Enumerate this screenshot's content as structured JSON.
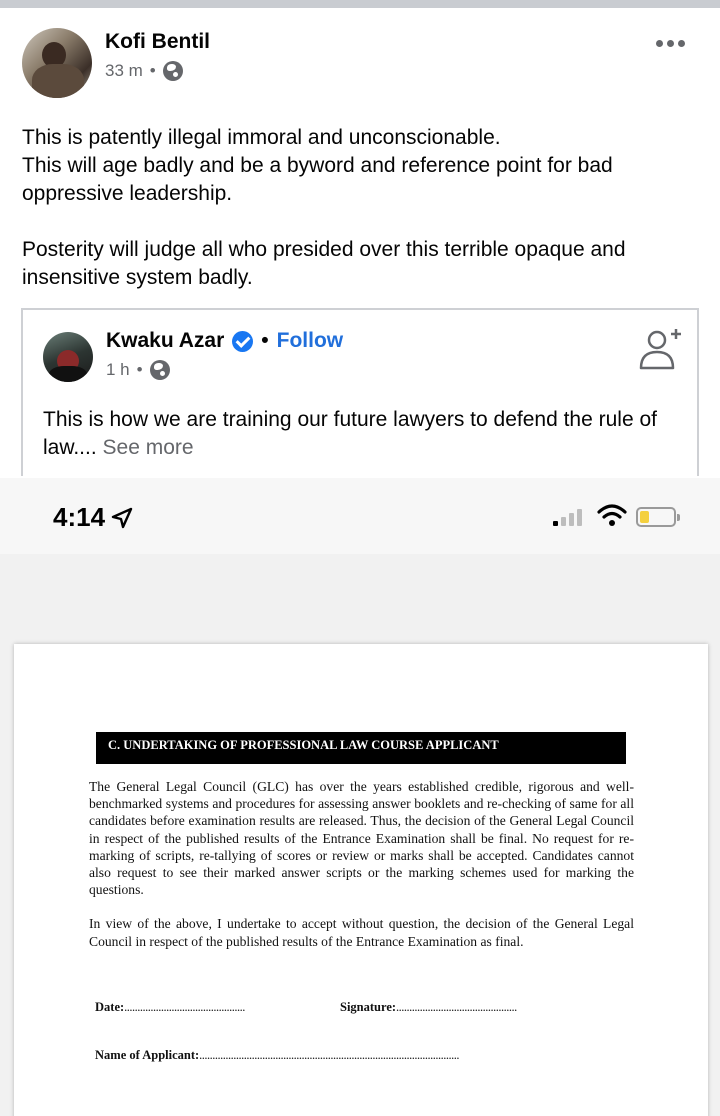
{
  "post": {
    "author": "Kofi Bentil",
    "time": "33 m",
    "separator": "•",
    "paragraphs": [
      "This is patently illegal immoral and unconscionable.",
      "This will age badly and be a byword and reference point for bad oppressive leadership.",
      "Posterity will judge all who presided over this terrible opaque and insensitive system badly."
    ]
  },
  "shared_post": {
    "author": "Kwaku Azar",
    "separator": "•",
    "follow_label": "Follow",
    "time": "1 h",
    "text": "This is how we are training our future lawyers to defend the rule of law....",
    "see_more_label": "See more"
  },
  "phone_status": {
    "time": "4:14"
  },
  "document": {
    "heading": "C. UNDERTAKING OF PROFESSIONAL LAW COURSE APPLICANT",
    "paragraph_1": "The General Legal Council (GLC) has over the years established credible, rigorous and well-benchmarked systems and procedures for assessing answer booklets and re-checking of same for all candidates before examination results are released. Thus, the decision of the General Legal Council in respect of the published results of the Entrance Examination shall be final. No request for re-marking of scripts, re-tallying of scores or review or marks shall be accepted. Candidates cannot also request to see their marked answer scripts or the marking schemes used for marking the questions.",
    "paragraph_2": "In view of the above, I undertake to accept without question, the decision of the General Legal Council in respect of the published results of the Entrance Examination as final.",
    "date_label": "Date:",
    "date_line": "..............................................",
    "signature_label": "Signature:",
    "signature_line": "..............................................",
    "name_label": "Name of Applicant:",
    "name_line": "..................................................................................................."
  },
  "colors": {
    "link_blue": "#216fdb",
    "verified_blue": "#1877f2",
    "meta_gray": "#65676b",
    "battery_yellow": "#f4d03f"
  },
  "icons": {
    "privacy": "globe-icon",
    "more": "more-dots-icon",
    "verified": "verified-badge-icon",
    "add_friend": "add-friend-icon",
    "location": "location-arrow-icon",
    "wifi": "wifi-icon",
    "battery": "battery-icon",
    "signal": "cellular-signal-icon"
  }
}
